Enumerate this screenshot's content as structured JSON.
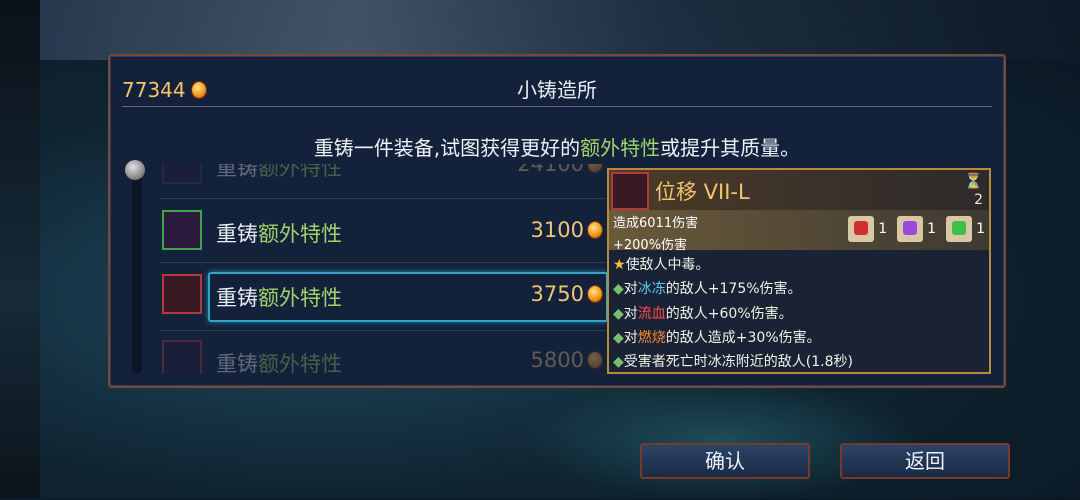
{
  "currency": {
    "amount": "77344",
    "icon": "gold-coin-icon"
  },
  "header": {
    "title": "小铸造所"
  },
  "subtitle": {
    "before": "重铸一件装备,试图获得更好的",
    "highlight": "额外特性",
    "after": "或提升其质量。"
  },
  "list": {
    "items": [
      {
        "prefix": "重铸",
        "green": "额外特性",
        "price": "24100",
        "state": "dim"
      },
      {
        "prefix": "重铸",
        "green": "额外特性",
        "price": "3100",
        "state": "normal"
      },
      {
        "prefix": "重铸",
        "green": "额外特性",
        "price": "3750",
        "state": "selected"
      },
      {
        "prefix": "重铸",
        "green": "额外特性",
        "price": "5800",
        "state": "dim"
      }
    ]
  },
  "tooltip": {
    "name": "位移 VII-L",
    "hourglass": "⏳",
    "level": "2",
    "damage": "造成6011伤害",
    "damage_bonus": "+200%伤害",
    "scrolls": [
      {
        "icon": "brutality-scroll-icon",
        "count": "1",
        "color": "#d03030"
      },
      {
        "icon": "tactics-scroll-icon",
        "count": "1",
        "color": "#9a4ad8"
      },
      {
        "icon": "survival-scroll-icon",
        "count": "1",
        "color": "#3fbf4a"
      }
    ],
    "effects": {
      "e1": "使敌人中毒。",
      "e2_pre": "对",
      "e2_hl": "冰冻",
      "e2_post": "的敌人+175%伤害。",
      "e3_pre": "对",
      "e3_hl": "流血",
      "e3_post": "的敌人+60%伤害。",
      "e4_pre": "对",
      "e4_hl": "燃烧",
      "e4_post": "的敌人造成+30%伤害。",
      "e5": "受害者死亡时冰冻附近的敌人(1.8秒)"
    }
  },
  "buttons": {
    "confirm": "确认",
    "back": "返回"
  }
}
